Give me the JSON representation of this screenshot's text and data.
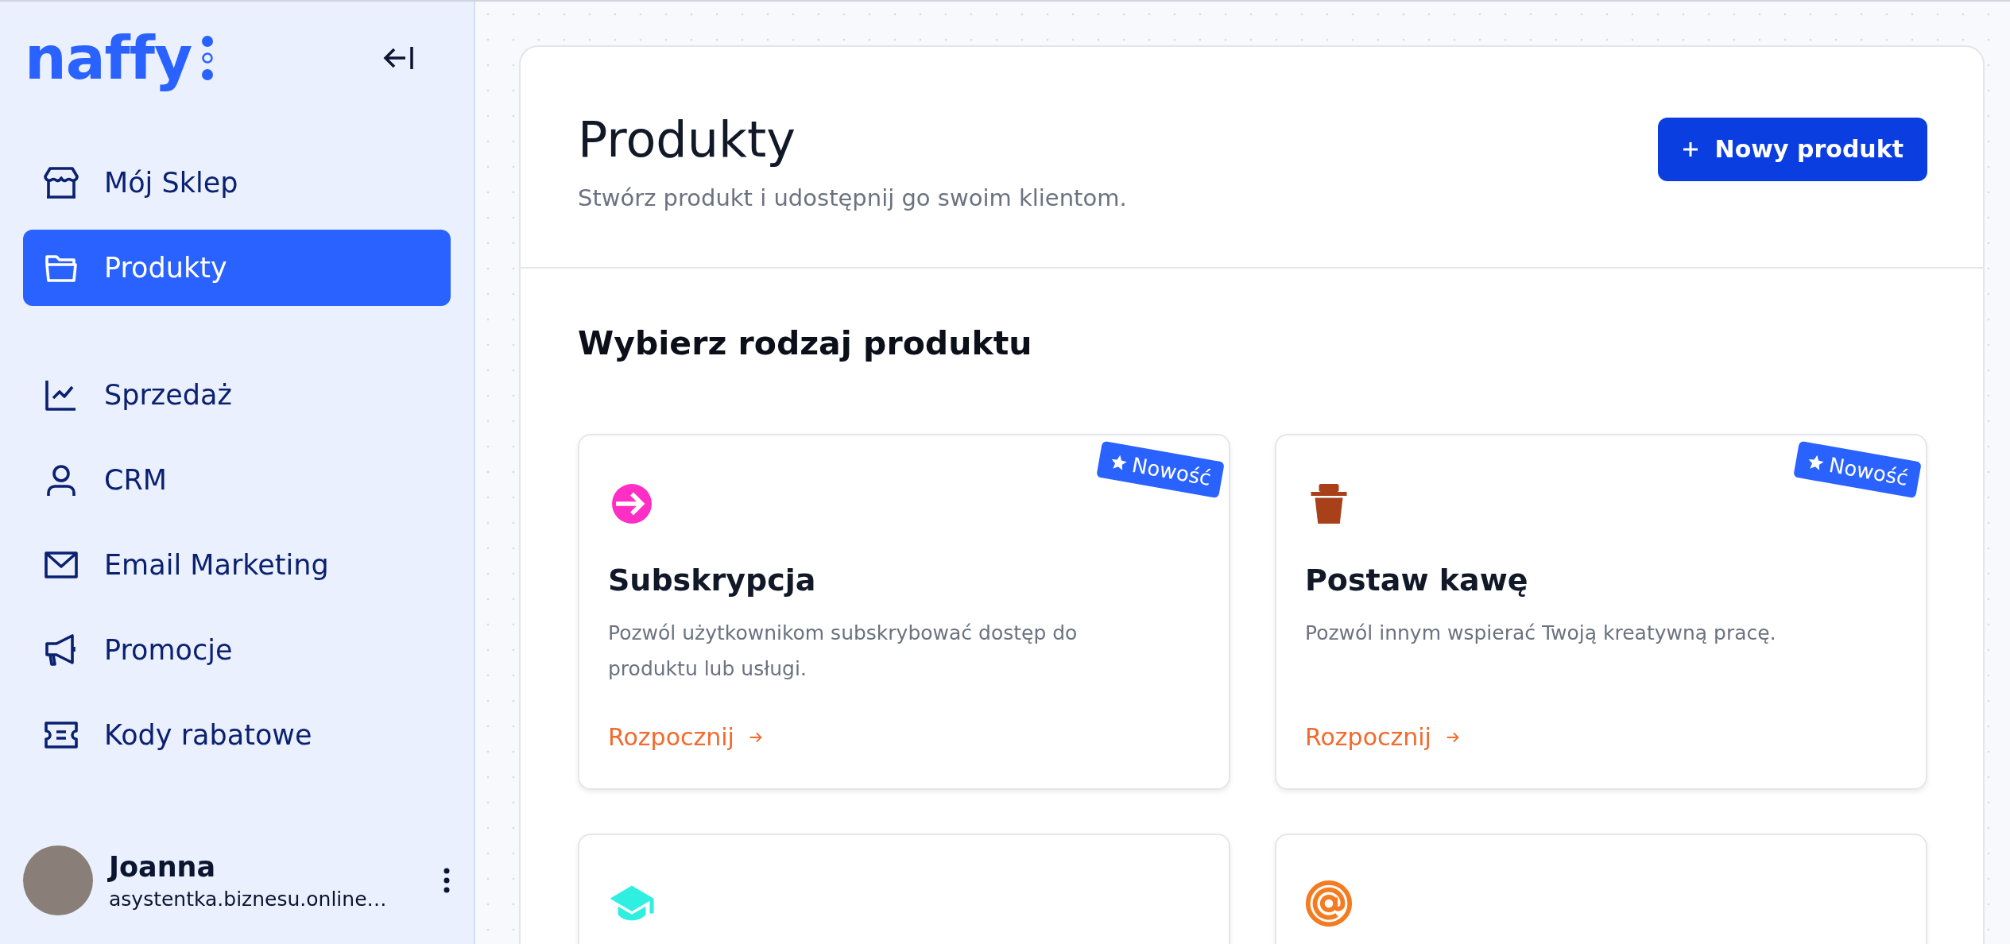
{
  "sidebar": {
    "logo": "naffy",
    "nav": [
      {
        "label": "Mój Sklep",
        "kind": "store",
        "selected": false
      },
      {
        "label": "Produkty",
        "kind": "folder",
        "selected": true
      },
      {
        "label": "Sprzedaż",
        "kind": "chart",
        "selected": false
      },
      {
        "label": "CRM",
        "kind": "user",
        "selected": false
      },
      {
        "label": "Email Marketing",
        "kind": "mail",
        "selected": false
      },
      {
        "label": "Promocje",
        "kind": "megaphone",
        "selected": false
      },
      {
        "label": "Kody rabatowe",
        "kind": "ticket",
        "selected": false
      }
    ],
    "user": {
      "name": "Joanna",
      "email": "asystentka.biznesu.online…"
    }
  },
  "header": {
    "title": "Produkty",
    "subtitle": "Stwórz produkt i udostępnij go swoim klientom.",
    "button": "Nowy produkt"
  },
  "section_title": "Wybierz rodzaj produktu",
  "cards": [
    {
      "kind": "arrow-circle",
      "color": "#ff2ec4",
      "title": "Subskrypcja",
      "description": "Pozwól użytkownikom subskrybować dostęp do produktu lub usługi.",
      "link": "Rozpocznij",
      "badge": "Nowość"
    },
    {
      "kind": "cup",
      "color": "#a8401a",
      "title": "Postaw kawę",
      "description": "Pozwól innym wspierać Twoją kreatywną pracę.",
      "link": "Rozpocznij",
      "badge": "Nowość"
    },
    {
      "kind": "graduation-cap",
      "color": "#2ff0e0"
    },
    {
      "kind": "at-sign",
      "color": "#f47b20"
    }
  ]
}
